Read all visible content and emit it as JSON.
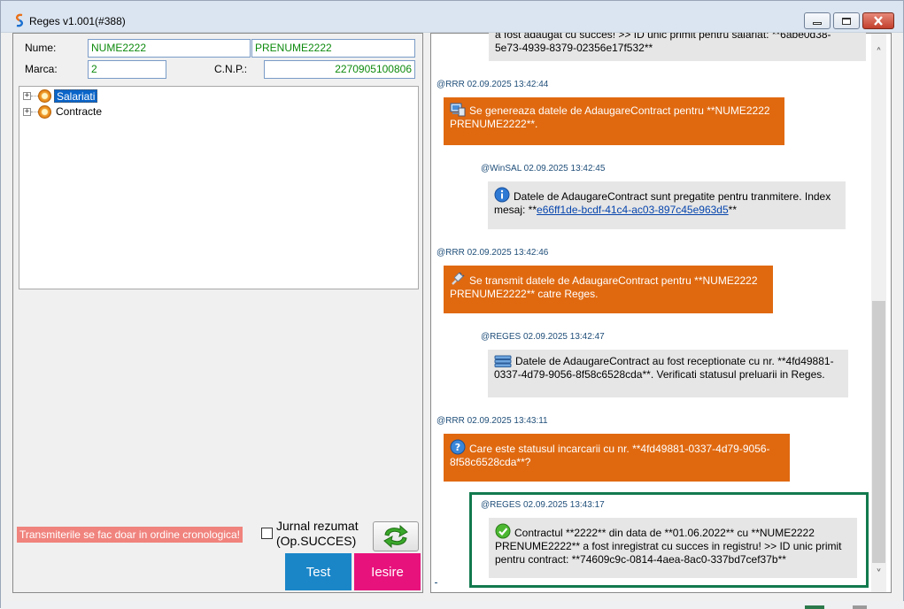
{
  "window": {
    "title": "Reges v1.001(#388)"
  },
  "form": {
    "nume_label": "Nume:",
    "nume_value": "NUME2222",
    "prenume_value": "PRENUME2222",
    "marca_label": "Marca:",
    "marca_value": "2",
    "cnp_label": "C.N.P.:",
    "cnp_value": "2270905100806"
  },
  "tree": {
    "items": [
      {
        "label": "Salariati",
        "icon": "folder-node-icon",
        "selected": true
      },
      {
        "label": "Contracte",
        "icon": "folder-node-icon",
        "selected": false
      }
    ]
  },
  "footer": {
    "warning": "Transmiterile se fac doar in ordine cronologica!",
    "journal_line1": "Jurnal rezumat",
    "journal_line2": "(Op.SUCCES)",
    "test_label": "Test",
    "exit_label": "Iesire"
  },
  "log": {
    "top_partial_line1": "a fost adaugat cu succes! >> ID unic primit pentru salariat: **6abe0d38-",
    "top_partial_line2": "5e73-4939-8379-02356e17f532**",
    "messages": [
      {
        "meta": "@RRR 02.09.2025 13:42:44",
        "line1": "Se genereaza datele de AdaugareContract pentru **NUME2222",
        "line2": "PRENUME2222**.",
        "icon": "computer-icon"
      },
      {
        "meta": "@WinSAL 02.09.2025 13:42:45",
        "line1": "Datele de AdaugareContract sunt pregatite pentru tranmitere. Index",
        "line2_prefix": "mesaj: **",
        "link": "e66ff1de-bcdf-41c4-ac03-897c45e963d5",
        "line2_suffix": "**",
        "icon": "info-icon"
      },
      {
        "meta": "@RRR 02.09.2025 13:42:46",
        "line1": "Se transmit datele de AdaugareContract pentru **NUME2222",
        "line2": "PRENUME2222** catre Reges.",
        "icon": "plug-icon"
      },
      {
        "meta": "@REGES 02.09.2025 13:42:47",
        "line1": "Datele de AdaugareContract au fost receptionate cu nr. **4fd49881-",
        "line2": "0337-4d79-9056-8f58c6528cda**. Verificati statusul preluarii in Reges.",
        "icon": "server-icon"
      },
      {
        "meta": "@RRR 02.09.2025 13:43:11",
        "line1": "Care este statusul incarcarii cu nr. **4fd49881-0337-4d79-9056-",
        "line2": "8f58c6528cda**?",
        "icon": "question-icon"
      },
      {
        "meta": "@REGES 02.09.2025 13:43:17",
        "line1": "Contractul **2222** din data de **01.06.2022** cu **NUME2222",
        "line2": "PRENUME2222** a fost inregistrat cu succes in registru! >> ID unic primit",
        "line3": "pentru contract: **74609c9c-0814-4aea-8ac0-337bd7cef37b**",
        "icon": "success-check-icon"
      }
    ]
  },
  "colors": {
    "rrr_bubble": "#e06910",
    "reply_bubble": "#e6e6e6",
    "highlight_border": "#127a4e",
    "test_button": "#1a86c8",
    "exit_button": "#e8127c",
    "field_text": "#0d8a0d"
  }
}
